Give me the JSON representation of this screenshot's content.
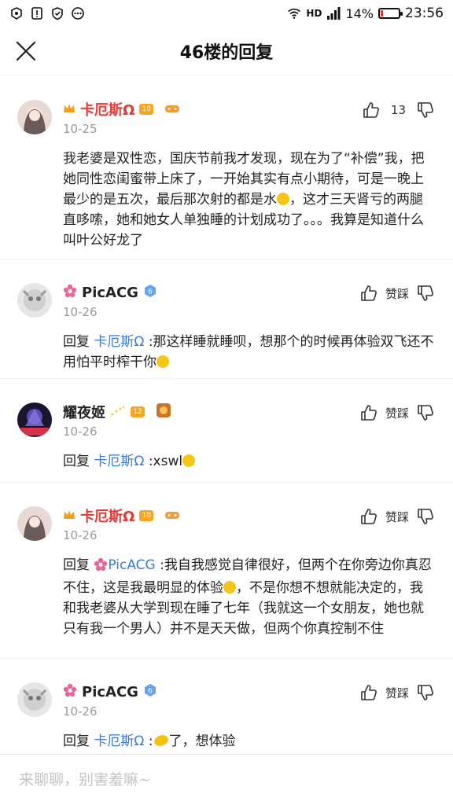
{
  "status_bar": {
    "signal_label": "HD",
    "battery": "14%",
    "battery_level": 0.14,
    "time": "23:56"
  },
  "header": {
    "title": "46楼的回复"
  },
  "comments": [
    {
      "user": "卡厄斯Ω",
      "level": "10",
      "date": "10-25",
      "like_text": "13",
      "reply_label": "",
      "reply_to": "",
      "text": "我老婆是双性恋，国庆节前我才发现，现在为了“补偿”我，把她同性恋闺蜜带上床了，一开始其实有点小期待，可是一晚上最少的是五次，最后那次射的都是水",
      "text2": "，这才三天肾亏的两腿直哆嗦，她和她女人单独睡的计划成功了。。。我算是知道什么叫叶公好龙了"
    },
    {
      "user": "PicACG",
      "level": "6",
      "date": "10-26",
      "like_text": "赞踩",
      "reply_label": "回复",
      "reply_to": "卡厄斯Ω",
      "text": ":那这样睡就睡呗，想那个的时候再体验双飞还不用怕平时榨干你",
      "text2": ""
    },
    {
      "user": "耀夜姬",
      "level": "12",
      "date": "10-26",
      "like_text": "赞踩",
      "reply_label": "回复",
      "reply_to": "卡厄斯Ω",
      "text": ":xswl",
      "text2": ""
    },
    {
      "user": "卡厄斯Ω",
      "level": "10",
      "date": "10-26",
      "like_text": "赞踩",
      "reply_label": "回复",
      "reply_to": "PicACG",
      "text": ":我自我感觉自律很好，但两个在你旁边你真忍不住，这是我最明显的体验",
      "text2": "，不是你想不想就能决定的，我和我老婆从大学到现在睡了七年（我就这一个女朋友，她也就只有我一个男人）并不是天天做，但两个你真控制不住"
    },
    {
      "user": "PicACG",
      "level": "6",
      "date": "10-26",
      "like_text": "赞踩",
      "reply_label": "回复",
      "reply_to": "卡厄斯Ω",
      "text": ":",
      "text2": "了，想体验"
    }
  ],
  "input": {
    "placeholder": "来聊聊，别害羞嘛~"
  },
  "colors": {
    "accent_red": "#e53935",
    "link_blue": "#3c7bd8"
  }
}
